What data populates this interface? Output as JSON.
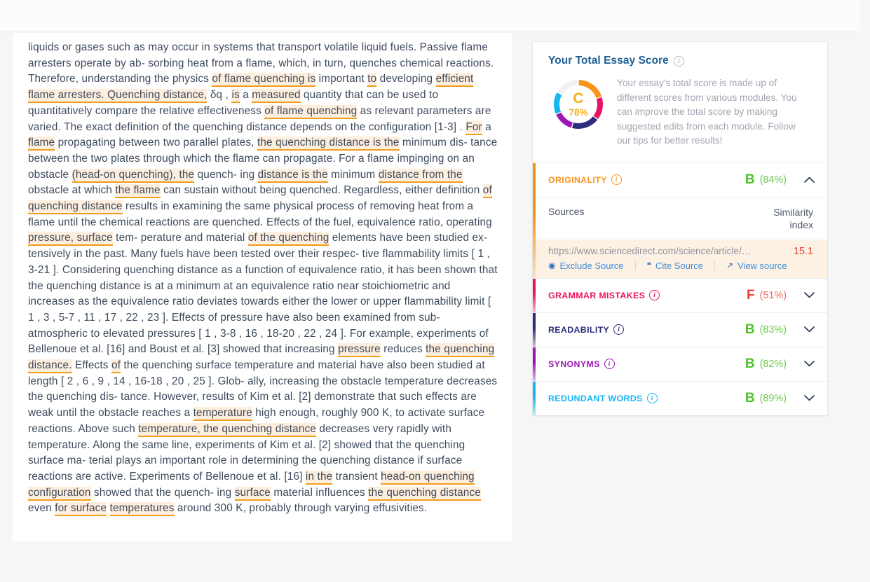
{
  "document": {
    "paragraph_runs": [
      {
        "t": "liquids or gases such as may occur in systems that transport volatile liquid fuels. Passive flame arresters operate by ab- sorbing heat from a flame, which, in turn, quenches chemical reactions. Therefore, understanding the physics ",
        "h": false
      },
      {
        "t": "of flame quenching is",
        "h": true
      },
      {
        "t": " important ",
        "h": false
      },
      {
        "t": "to",
        "h": true
      },
      {
        "t": " developing ",
        "h": false
      },
      {
        "t": "efficient flame arresters. Quenching distance,",
        "h": true
      },
      {
        "t": " δq , ",
        "h": false
      },
      {
        "t": "is",
        "h": true
      },
      {
        "t": " a ",
        "h": false
      },
      {
        "t": "measured",
        "h": true
      },
      {
        "t": " quantity that can be used to quantitatively compare the relative effectiveness ",
        "h": false
      },
      {
        "t": "of flame quenching",
        "h": true
      },
      {
        "t": " as relevant parameters are varied. The exact definition of the quenching distance depends on the configuration [1-3] . ",
        "h": false
      },
      {
        "t": "For",
        "h": true
      },
      {
        "t": " a ",
        "h": false
      },
      {
        "t": "flame",
        "h": true
      },
      {
        "t": " propagating between two parallel plates, ",
        "h": false
      },
      {
        "t": "the quenching distance is the",
        "h": true
      },
      {
        "t": " minimum dis- tance between the two plates through which the flame can propagate. For a flame impinging on an obstacle ",
        "h": false
      },
      {
        "t": "(head-on quenching), the",
        "h": true
      },
      {
        "t": " quench- ing ",
        "h": false
      },
      {
        "t": "distance is the",
        "h": true
      },
      {
        "t": " minimum ",
        "h": false
      },
      {
        "t": "distance from the",
        "h": true
      },
      {
        "t": " obstacle at which ",
        "h": false
      },
      {
        "t": "the flame",
        "h": true
      },
      {
        "t": " can sustain without being quenched. Regardless, either definition ",
        "h": false
      },
      {
        "t": "of quenching distance",
        "h": true
      },
      {
        "t": " results in examining the same physical process of removing heat from a flame until the chemical reactions are quenched. Effects of the fuel, equivalence ratio, operating ",
        "h": false
      },
      {
        "t": "pressure, surface",
        "h": true
      },
      {
        "t": " tem- perature and material ",
        "h": false
      },
      {
        "t": "of the quenching",
        "h": true
      },
      {
        "t": " elements have been studied ex- tensively in the past. Many fuels have been tested over their respec- tive flammability limits [ 1 , 3-21 ]. Considering quenching distance as a function of equivalence ratio, it has been shown that the quenching distance is at a minimum at an equivalence ratio near stoichiometric and increases as the equivalence ratio deviates towards either the lower or upper flammability limit [ 1 , 3 , 5-7 , 11 , 17 , 22 , 23 ]. Effects of pressure have also been examined from sub-atmospheric to elevated pressures [ 1 , 3-8 , 16 , 18-20 , 22 , 24 ]. For example, experiments of Bellenoue et al. [16] and Boust et al. [3] showed that increasing ",
        "h": false
      },
      {
        "t": "pressure",
        "h": true
      },
      {
        "t": " reduces ",
        "h": false
      },
      {
        "t": "the quenching distance.",
        "h": true
      },
      {
        "t": " Effects ",
        "h": false
      },
      {
        "t": "of",
        "h": true
      },
      {
        "t": " the quenching surface temperature and material have also been studied at length [ 2 , 6 , 9 , 14 , 16-18 , 20 , 25 ]. Glob- ally, increasing the obstacle temperature decreases the quenching dis- tance. However, results of Kim et al. [2] demonstrate that such effects are weak until the obstacle reaches a ",
        "h": false
      },
      {
        "t": "temperature",
        "h": true
      },
      {
        "t": " high enough, roughly 900 K, to activate surface reactions. Above such ",
        "h": false
      },
      {
        "t": "temperature, the quenching distance",
        "h": true
      },
      {
        "t": " decreases very rapidly with temperature. Along the same line, experiments of Kim et al. [2] showed that the quenching surface ma- terial plays an important role in determining the quenching distance if surface reactions are active. Experiments of Bellenoue et al. [16] ",
        "h": false
      },
      {
        "t": "in the",
        "h": true
      },
      {
        "t": " transient ",
        "h": false
      },
      {
        "t": "head-on quenching configuration",
        "h": true
      },
      {
        "t": " showed that the quench- ing ",
        "h": false
      },
      {
        "t": "surface",
        "h": true
      },
      {
        "t": " material influences ",
        "h": false
      },
      {
        "t": "the quenching distance",
        "h": true
      },
      {
        "t": " even ",
        "h": false
      },
      {
        "t": "for surface",
        "h": true
      },
      {
        "t": " ",
        "h": false
      },
      {
        "t": "temperatures",
        "h": true
      },
      {
        "t": " around 300 K, probably through varying effusivities.",
        "h": false
      }
    ]
  },
  "score_panel": {
    "total": {
      "title": "Your Total Essay Score",
      "info_icon": "info-icon",
      "grade": "C",
      "percent": "78%",
      "description": "Your essay's total score is made up of different scores from various modules. You can improve the total score by making suggested edits from each module. Follow our tips for better results!",
      "donut_segments": [
        {
          "name": "originality",
          "color": "#f7941e",
          "from": 0,
          "to": 72
        },
        {
          "name": "grammar",
          "color": "#ec1164",
          "from": 72,
          "to": 128
        },
        {
          "name": "readability",
          "color": "#2b2c7c",
          "from": 128,
          "to": 196
        },
        {
          "name": "synonyms",
          "color": "#9b17b4",
          "from": 196,
          "to": 246
        },
        {
          "name": "redundant",
          "color": "#17b6f2",
          "from": 246,
          "to": 300
        },
        {
          "name": "empty",
          "color": "#f2f2f4",
          "from": 300,
          "to": 360
        }
      ]
    },
    "modules": [
      {
        "id": "originality",
        "label": "ORIGINALITY",
        "label_color": "#f7941e",
        "bar_color": "#f7941e",
        "grade": "B",
        "grade_color": "#4cc22a",
        "percent": "(84%)",
        "expanded": true,
        "chevron": "⌃",
        "sources_label": "Sources",
        "similarity_label": "Similarity index",
        "sources": [
          {
            "url": "https://www.sciencedirect.com/science/article/…",
            "score": "15.1",
            "actions": [
              {
                "label": "Exclude Source",
                "icon": "eye-icon",
                "glyph": "◉"
              },
              {
                "label": "Cite Source",
                "icon": "quote-icon",
                "glyph": "❝"
              },
              {
                "label": "View source",
                "icon": "external-link-icon",
                "glyph": "↗"
              }
            ]
          }
        ]
      },
      {
        "id": "grammar",
        "label": "GRAMMAR MISTAKES",
        "label_color": "#ec1164",
        "bar_color": "#ec1164",
        "grade": "F",
        "grade_color": "#f13b30",
        "percent": "(51%)",
        "percent_color": "#f36a61",
        "expanded": false,
        "chevron": "⌄"
      },
      {
        "id": "readability",
        "label": "READABILITY",
        "label_color": "#2b2c7c",
        "bar_color": "#2b2c7c",
        "grade": "B",
        "grade_color": "#4cc22a",
        "percent": "(83%)",
        "expanded": false,
        "chevron": "⌄"
      },
      {
        "id": "synonyms",
        "label": "SYNONYMS",
        "label_color": "#9b17b4",
        "bar_color": "#9b17b4",
        "grade": "B",
        "grade_color": "#4cc22a",
        "percent": "(82%)",
        "expanded": false,
        "chevron": "⌄"
      },
      {
        "id": "redundant",
        "label": "REDUNDANT WORDS",
        "label_color": "#17b6f2",
        "bar_color": "#17b6f2",
        "grade": "B",
        "grade_color": "#4cc22a",
        "percent": "(89%)",
        "expanded": false,
        "chevron": "⌄"
      }
    ],
    "grade_green": "#4cc22a",
    "pct_green": "#6ecb4f"
  }
}
